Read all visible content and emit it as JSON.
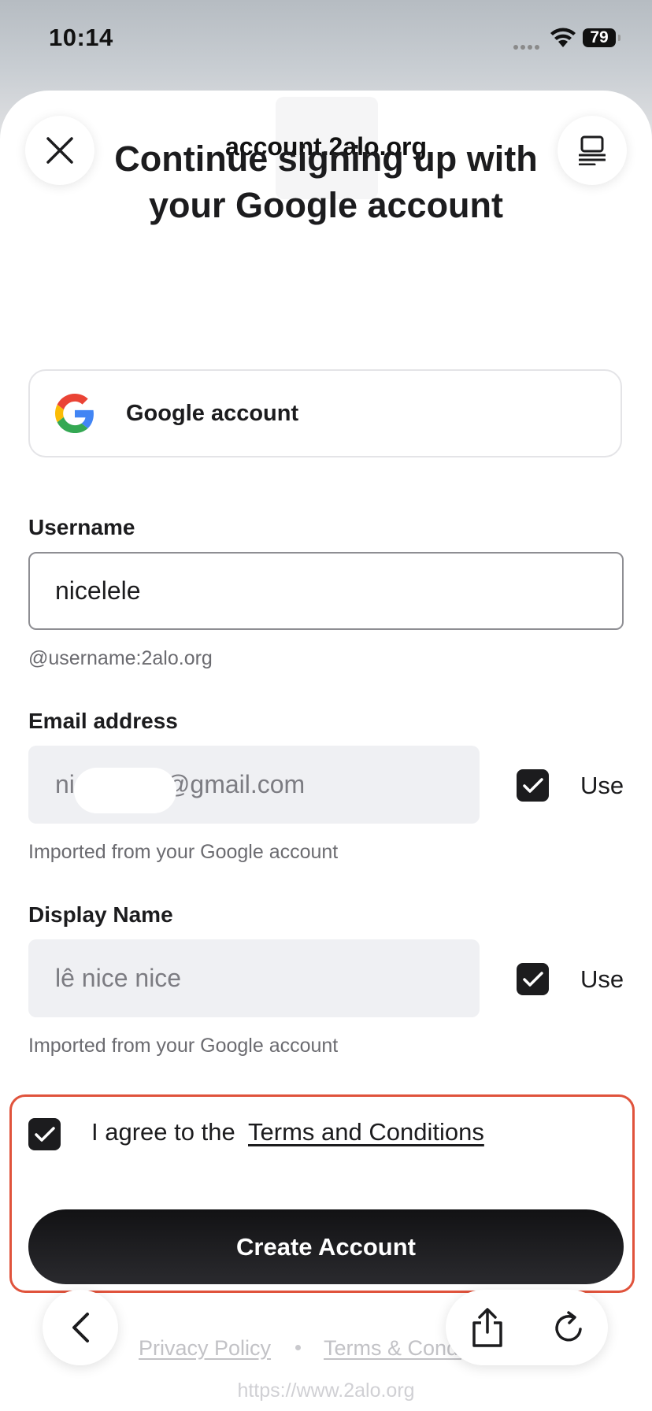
{
  "status_bar": {
    "time": "10:14",
    "battery": "79"
  },
  "browser": {
    "site_title": "account.2alo.org",
    "url": "https://www.2alo.org"
  },
  "page": {
    "heading_line1": "Continue signing up with",
    "heading_line2": "your Google account",
    "google_card_label": "Google account",
    "username": {
      "label": "Username",
      "value": "nicelele",
      "helper": "@username:2alo.org"
    },
    "email": {
      "label": "Email address",
      "value_prefix": "ni",
      "value_suffix": "@gmail.com",
      "use_label": "Use",
      "use_checked": true,
      "helper": "Imported from your Google account"
    },
    "display_name": {
      "label": "Display Name",
      "value": "lê nice nice",
      "use_label": "Use",
      "use_checked": true,
      "helper": "Imported from your Google account"
    },
    "agree": {
      "text": "I agree to the",
      "link": "Terms and Conditions",
      "checked": true
    },
    "create_button": "Create Account",
    "footer": {
      "privacy": "Privacy Policy",
      "terms": "Terms & Conditions"
    }
  },
  "colors": {
    "primary_dark": "#1c1c1e",
    "highlight": "#e0533c",
    "input_disabled_bg": "#eff0f3"
  },
  "icons": [
    "close-icon",
    "reader-mode-icon",
    "google-logo-icon",
    "checkmark-icon",
    "back-arrow-icon",
    "share-icon",
    "reload-icon",
    "wifi-icon",
    "battery-icon"
  ]
}
